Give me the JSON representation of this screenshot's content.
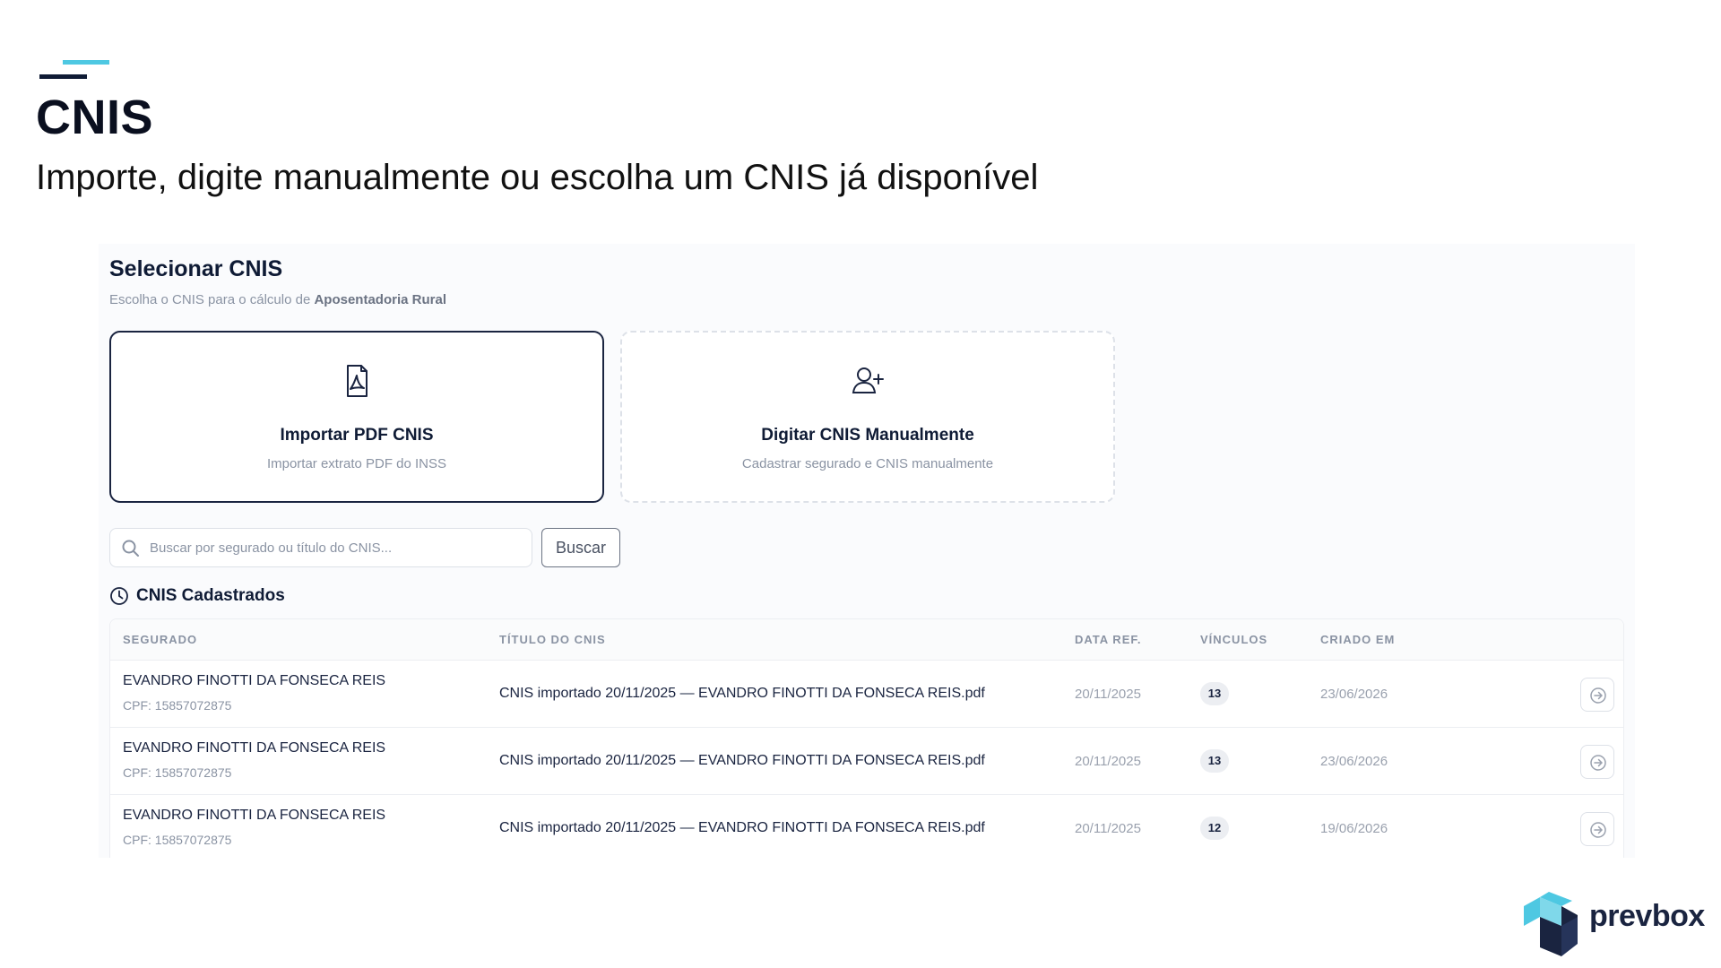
{
  "slide": {
    "title": "CNIS",
    "subtitle": "Importe, digite manualmente ou escolha um CNIS já disponível"
  },
  "panel": {
    "title": "Selecionar CNIS",
    "desc_prefix": "Escolha o CNIS para o cálculo de ",
    "desc_bold": "Aposentadoria Rural"
  },
  "cards": {
    "import": {
      "icon": "pdf-file-icon",
      "title": "Importar PDF CNIS",
      "subtitle": "Importar extrato PDF do INSS"
    },
    "manual": {
      "icon": "user-plus-icon",
      "title": "Digitar CNIS Manualmente",
      "subtitle": "Cadastrar segurado e CNIS manualmente"
    }
  },
  "search": {
    "placeholder": "Buscar por segurado ou título do CNIS...",
    "value": "",
    "button_label": "Buscar"
  },
  "section": {
    "icon": "clock-icon",
    "title": "CNIS Cadastrados"
  },
  "table": {
    "headers": [
      "SEGURADO",
      "TÍTULO DO CNIS",
      "DATA REF.",
      "VÍNCULOS",
      "CRIADO EM"
    ],
    "rows": [
      {
        "name": "EVANDRO FINOTTI DA FONSECA REIS",
        "cpf": "CPF: 15857072875",
        "title": "CNIS importado 20/11/2025 — EVANDRO FINOTTI DA FONSECA REIS.pdf",
        "data_ref": "20/11/2025",
        "vinculos": "13",
        "criado_em": "23/06/2026"
      },
      {
        "name": "EVANDRO FINOTTI DA FONSECA REIS",
        "cpf": "CPF: 15857072875",
        "title": "CNIS importado 20/11/2025 — EVANDRO FINOTTI DA FONSECA REIS.pdf",
        "data_ref": "20/11/2025",
        "vinculos": "13",
        "criado_em": "23/06/2026"
      },
      {
        "name": "EVANDRO FINOTTI DA FONSECA REIS",
        "cpf": "CPF: 15857072875",
        "title": "CNIS importado 20/11/2025 — EVANDRO FINOTTI DA FONSECA REIS.pdf",
        "data_ref": "20/11/2025",
        "vinculos": "12",
        "criado_em": "19/06/2026"
      }
    ],
    "row_action_icon": "arrow-circle-right-icon"
  },
  "logo": {
    "brand": "prevbox"
  },
  "colors": {
    "navy": "#0f1b35",
    "cyan": "#4ec8e2",
    "muted": "#8a93a3",
    "border": "#dde1e8"
  }
}
